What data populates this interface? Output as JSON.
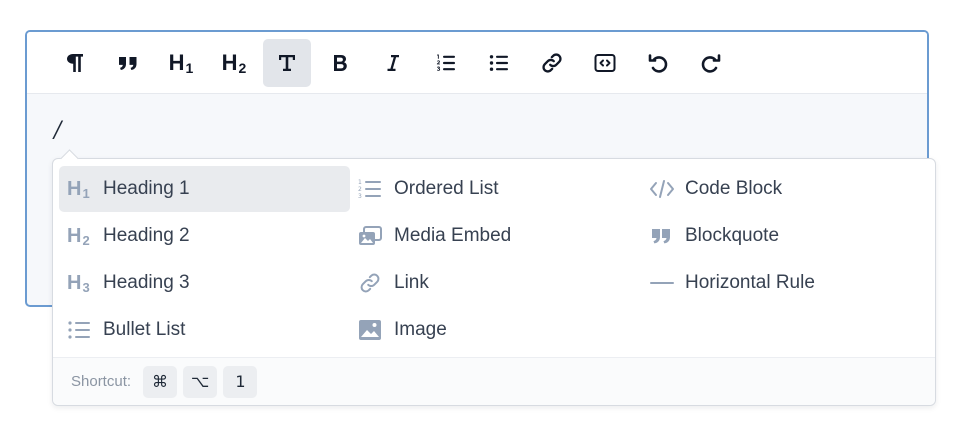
{
  "toolbar": {
    "buttons": [
      {
        "icon": "pilcrow-icon",
        "label": "",
        "active": false
      },
      {
        "icon": "quote-icon",
        "label": "",
        "active": false
      },
      {
        "icon": "heading-1-icon",
        "text": "H",
        "sub": "1",
        "active": false
      },
      {
        "icon": "heading-2-icon",
        "text": "H",
        "sub": "2",
        "active": false
      },
      {
        "icon": "text-icon",
        "active": true
      },
      {
        "icon": "bold-icon",
        "active": false
      },
      {
        "icon": "italic-icon",
        "active": false
      },
      {
        "icon": "ordered-list-icon",
        "active": false
      },
      {
        "icon": "bullet-list-icon",
        "active": false
      },
      {
        "icon": "link-icon",
        "active": false
      },
      {
        "icon": "code-embed-icon",
        "active": false
      },
      {
        "icon": "undo-icon",
        "active": false
      },
      {
        "icon": "redo-icon",
        "active": false
      }
    ]
  },
  "editor": {
    "typed_text": "/"
  },
  "menu": {
    "columns": [
      [
        {
          "label": "Heading 1",
          "icon": "heading-1-icon",
          "icon_text": "H",
          "icon_sub": "1",
          "active": true
        },
        {
          "label": "Heading 2",
          "icon": "heading-2-icon",
          "icon_text": "H",
          "icon_sub": "2"
        },
        {
          "label": "Heading 3",
          "icon": "heading-3-icon",
          "icon_text": "H",
          "icon_sub": "3"
        },
        {
          "label": "Bullet List",
          "icon": "bullet-list-icon"
        }
      ],
      [
        {
          "label": "Ordered List",
          "icon": "ordered-list-icon"
        },
        {
          "label": "Media Embed",
          "icon": "media-embed-icon"
        },
        {
          "label": "Link",
          "icon": "link-icon"
        },
        {
          "label": "Image",
          "icon": "image-icon"
        }
      ],
      [
        {
          "label": "Code Block",
          "icon": "code-icon"
        },
        {
          "label": "Blockquote",
          "icon": "quote-icon"
        },
        {
          "label": "Horizontal Rule",
          "icon": "horizontal-rule-icon"
        }
      ]
    ],
    "footer": {
      "shortcut_label": "Shortcut:",
      "keys": [
        "⌘",
        "⌥",
        "1"
      ]
    }
  },
  "colors": {
    "accent_border": "#6b9bd1",
    "menu_icon": "#94a3b8",
    "active_bg": "#e9ebee"
  }
}
